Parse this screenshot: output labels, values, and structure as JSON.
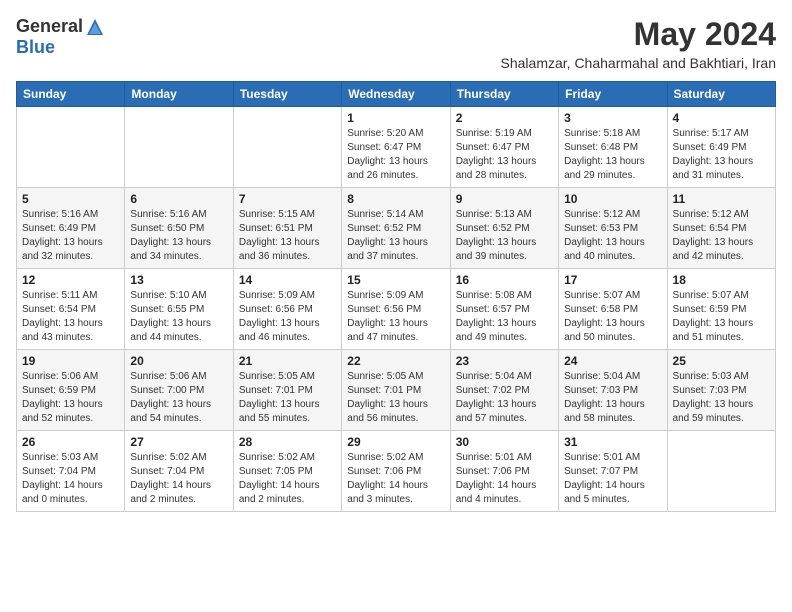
{
  "header": {
    "logo_general": "General",
    "logo_blue": "Blue",
    "month_title": "May 2024",
    "subtitle": "Shalamzar, Chaharmahal and Bakhtiari, Iran"
  },
  "days_of_week": [
    "Sunday",
    "Monday",
    "Tuesday",
    "Wednesday",
    "Thursday",
    "Friday",
    "Saturday"
  ],
  "weeks": [
    [
      {
        "day": "",
        "info": ""
      },
      {
        "day": "",
        "info": ""
      },
      {
        "day": "",
        "info": ""
      },
      {
        "day": "1",
        "info": "Sunrise: 5:20 AM\nSunset: 6:47 PM\nDaylight: 13 hours\nand 26 minutes."
      },
      {
        "day": "2",
        "info": "Sunrise: 5:19 AM\nSunset: 6:47 PM\nDaylight: 13 hours\nand 28 minutes."
      },
      {
        "day": "3",
        "info": "Sunrise: 5:18 AM\nSunset: 6:48 PM\nDaylight: 13 hours\nand 29 minutes."
      },
      {
        "day": "4",
        "info": "Sunrise: 5:17 AM\nSunset: 6:49 PM\nDaylight: 13 hours\nand 31 minutes."
      }
    ],
    [
      {
        "day": "5",
        "info": "Sunrise: 5:16 AM\nSunset: 6:49 PM\nDaylight: 13 hours\nand 32 minutes."
      },
      {
        "day": "6",
        "info": "Sunrise: 5:16 AM\nSunset: 6:50 PM\nDaylight: 13 hours\nand 34 minutes."
      },
      {
        "day": "7",
        "info": "Sunrise: 5:15 AM\nSunset: 6:51 PM\nDaylight: 13 hours\nand 36 minutes."
      },
      {
        "day": "8",
        "info": "Sunrise: 5:14 AM\nSunset: 6:52 PM\nDaylight: 13 hours\nand 37 minutes."
      },
      {
        "day": "9",
        "info": "Sunrise: 5:13 AM\nSunset: 6:52 PM\nDaylight: 13 hours\nand 39 minutes."
      },
      {
        "day": "10",
        "info": "Sunrise: 5:12 AM\nSunset: 6:53 PM\nDaylight: 13 hours\nand 40 minutes."
      },
      {
        "day": "11",
        "info": "Sunrise: 5:12 AM\nSunset: 6:54 PM\nDaylight: 13 hours\nand 42 minutes."
      }
    ],
    [
      {
        "day": "12",
        "info": "Sunrise: 5:11 AM\nSunset: 6:54 PM\nDaylight: 13 hours\nand 43 minutes."
      },
      {
        "day": "13",
        "info": "Sunrise: 5:10 AM\nSunset: 6:55 PM\nDaylight: 13 hours\nand 44 minutes."
      },
      {
        "day": "14",
        "info": "Sunrise: 5:09 AM\nSunset: 6:56 PM\nDaylight: 13 hours\nand 46 minutes."
      },
      {
        "day": "15",
        "info": "Sunrise: 5:09 AM\nSunset: 6:56 PM\nDaylight: 13 hours\nand 47 minutes."
      },
      {
        "day": "16",
        "info": "Sunrise: 5:08 AM\nSunset: 6:57 PM\nDaylight: 13 hours\nand 49 minutes."
      },
      {
        "day": "17",
        "info": "Sunrise: 5:07 AM\nSunset: 6:58 PM\nDaylight: 13 hours\nand 50 minutes."
      },
      {
        "day": "18",
        "info": "Sunrise: 5:07 AM\nSunset: 6:59 PM\nDaylight: 13 hours\nand 51 minutes."
      }
    ],
    [
      {
        "day": "19",
        "info": "Sunrise: 5:06 AM\nSunset: 6:59 PM\nDaylight: 13 hours\nand 52 minutes."
      },
      {
        "day": "20",
        "info": "Sunrise: 5:06 AM\nSunset: 7:00 PM\nDaylight: 13 hours\nand 54 minutes."
      },
      {
        "day": "21",
        "info": "Sunrise: 5:05 AM\nSunset: 7:01 PM\nDaylight: 13 hours\nand 55 minutes."
      },
      {
        "day": "22",
        "info": "Sunrise: 5:05 AM\nSunset: 7:01 PM\nDaylight: 13 hours\nand 56 minutes."
      },
      {
        "day": "23",
        "info": "Sunrise: 5:04 AM\nSunset: 7:02 PM\nDaylight: 13 hours\nand 57 minutes."
      },
      {
        "day": "24",
        "info": "Sunrise: 5:04 AM\nSunset: 7:03 PM\nDaylight: 13 hours\nand 58 minutes."
      },
      {
        "day": "25",
        "info": "Sunrise: 5:03 AM\nSunset: 7:03 PM\nDaylight: 13 hours\nand 59 minutes."
      }
    ],
    [
      {
        "day": "26",
        "info": "Sunrise: 5:03 AM\nSunset: 7:04 PM\nDaylight: 14 hours\nand 0 minutes."
      },
      {
        "day": "27",
        "info": "Sunrise: 5:02 AM\nSunset: 7:04 PM\nDaylight: 14 hours\nand 2 minutes."
      },
      {
        "day": "28",
        "info": "Sunrise: 5:02 AM\nSunset: 7:05 PM\nDaylight: 14 hours\nand 2 minutes."
      },
      {
        "day": "29",
        "info": "Sunrise: 5:02 AM\nSunset: 7:06 PM\nDaylight: 14 hours\nand 3 minutes."
      },
      {
        "day": "30",
        "info": "Sunrise: 5:01 AM\nSunset: 7:06 PM\nDaylight: 14 hours\nand 4 minutes."
      },
      {
        "day": "31",
        "info": "Sunrise: 5:01 AM\nSunset: 7:07 PM\nDaylight: 14 hours\nand 5 minutes."
      },
      {
        "day": "",
        "info": ""
      }
    ]
  ]
}
